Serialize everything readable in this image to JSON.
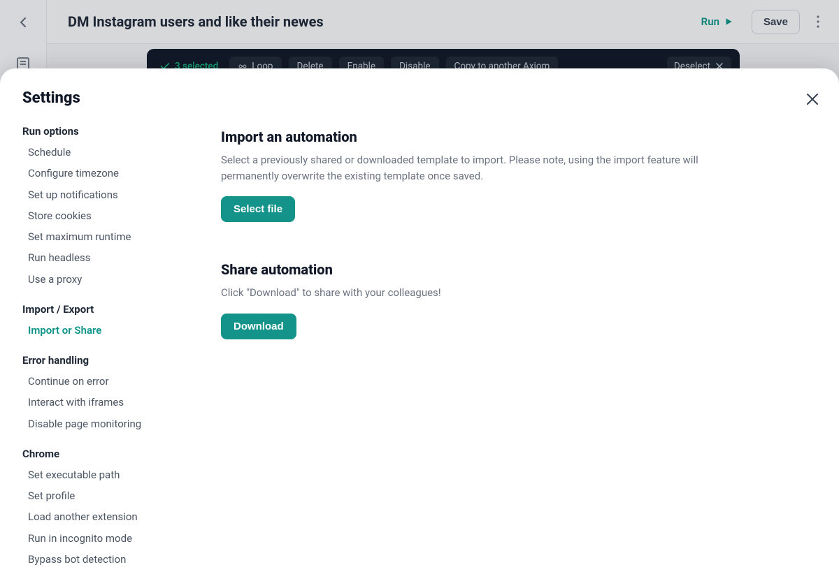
{
  "page": {
    "title": "DM Instagram users and like their newes"
  },
  "topbar": {
    "run_label": "Run",
    "save_label": "Save"
  },
  "selection_bar": {
    "count_label": "3 selected",
    "loop": "Loop",
    "delete": "Delete",
    "enable": "Enable",
    "disable": "Disable",
    "copy": "Copy to another Axiom",
    "deselect": "Deselect"
  },
  "settings": {
    "title": "Settings",
    "groups": {
      "run_options": {
        "label": "Run options",
        "items": [
          "Schedule",
          "Configure timezone",
          "Set up notifications",
          "Store cookies",
          "Set maximum runtime",
          "Run headless",
          "Use a proxy"
        ]
      },
      "import_export": {
        "label": "Import / Export",
        "items": [
          "Import or Share"
        ],
        "active_index": 0
      },
      "error_handling": {
        "label": "Error handling",
        "items": [
          "Continue on error",
          "Interact with iframes",
          "Disable page monitoring"
        ]
      },
      "chrome": {
        "label": "Chrome",
        "items": [
          "Set executable path",
          "Set profile",
          "Load another extension",
          "Run in incognito mode",
          "Bypass bot detection"
        ]
      }
    }
  },
  "main": {
    "import": {
      "heading": "Import an automation",
      "body": "Select a previously shared or downloaded template to import. Please note, using the import feature will permanently overwrite the existing template once saved.",
      "button": "Select file"
    },
    "share": {
      "heading": "Share automation",
      "body": "Click \"Download\" to share with your colleagues!",
      "button": "Download"
    }
  }
}
